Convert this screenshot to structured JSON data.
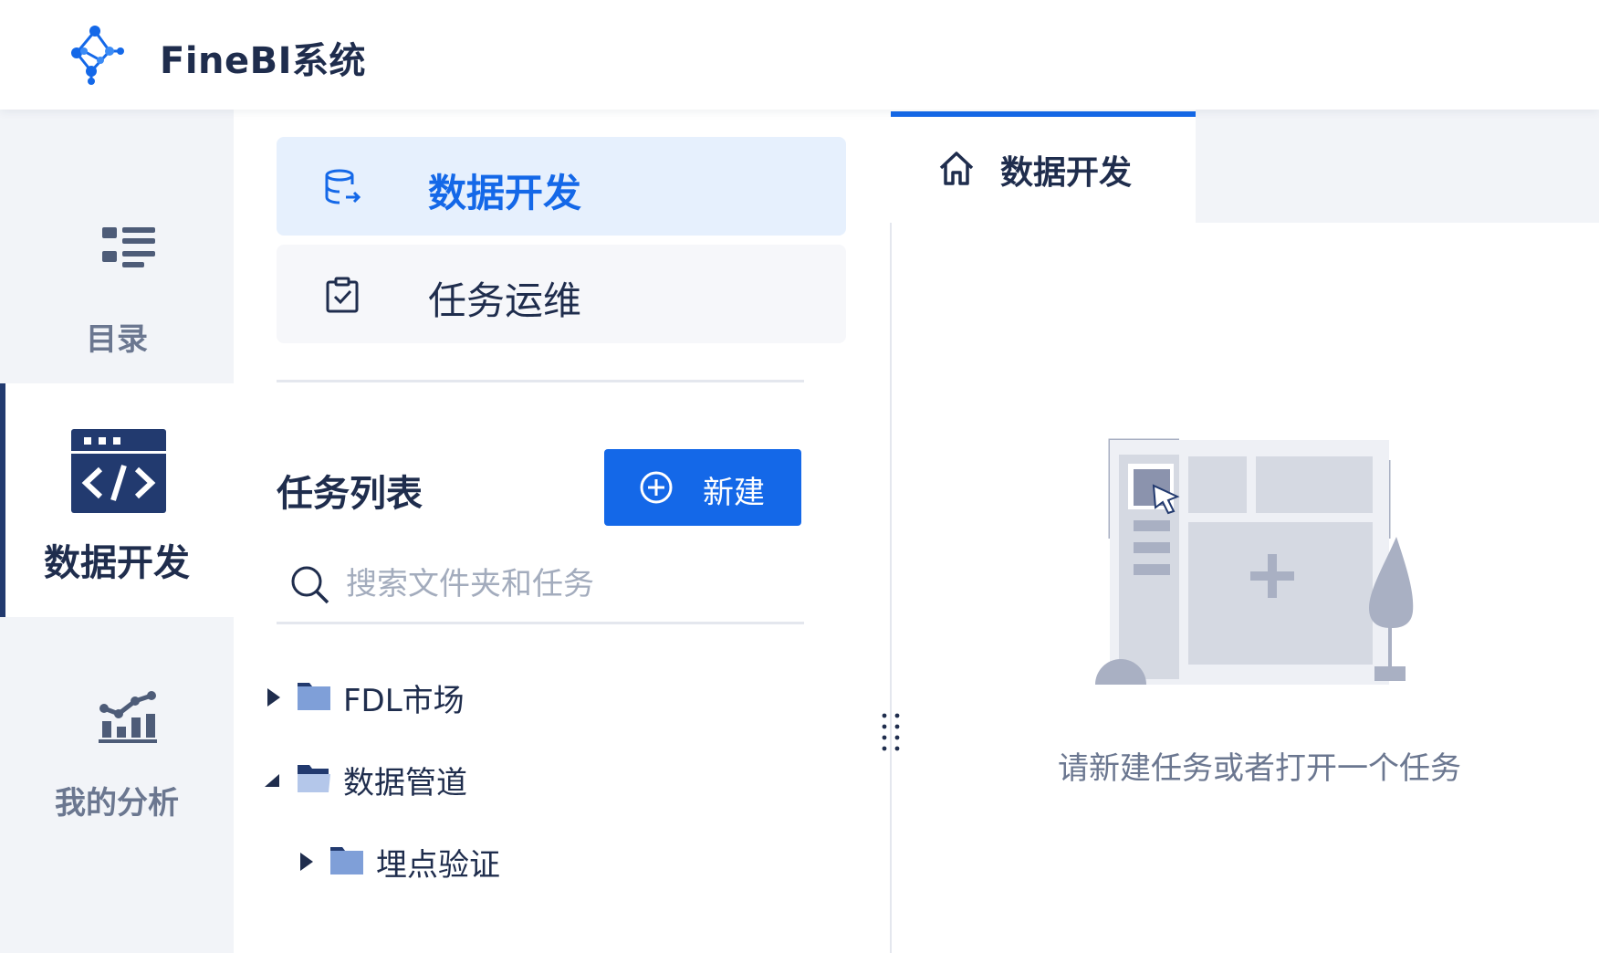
{
  "app": {
    "title": "FineBI系统",
    "logo_icon": "molecule-logo-icon",
    "brand_color": "#1468e8",
    "dark_color": "#223a6f"
  },
  "rail": {
    "items": [
      {
        "label": "目录",
        "icon": "list-icon",
        "active": false
      },
      {
        "label": "数据开发",
        "icon": "code-window-icon",
        "active": true
      },
      {
        "label": "我的分析",
        "icon": "analysis-chart-icon",
        "active": false
      }
    ]
  },
  "panel": {
    "nav": [
      {
        "label": "数据开发",
        "icon": "database-export-icon",
        "active": true
      },
      {
        "label": "任务运维",
        "icon": "clipboard-check-icon",
        "active": false
      }
    ],
    "list_title": "任务列表",
    "new_button": {
      "label": "新建",
      "icon": "plus-circle-icon"
    },
    "search": {
      "placeholder": "搜索文件夹和任务",
      "value": ""
    },
    "tree": [
      {
        "label": "FDL市场",
        "expanded": false,
        "level": 0
      },
      {
        "label": "数据管道",
        "expanded": true,
        "level": 0
      },
      {
        "label": "埋点验证",
        "expanded": false,
        "level": 1
      }
    ]
  },
  "tabs": [
    {
      "label": "数据开发",
      "icon": "home-icon",
      "active": true
    }
  ],
  "empty_state": {
    "message": "请新建任务或者打开一个任务",
    "illustration": "empty-workspace-illustration"
  }
}
